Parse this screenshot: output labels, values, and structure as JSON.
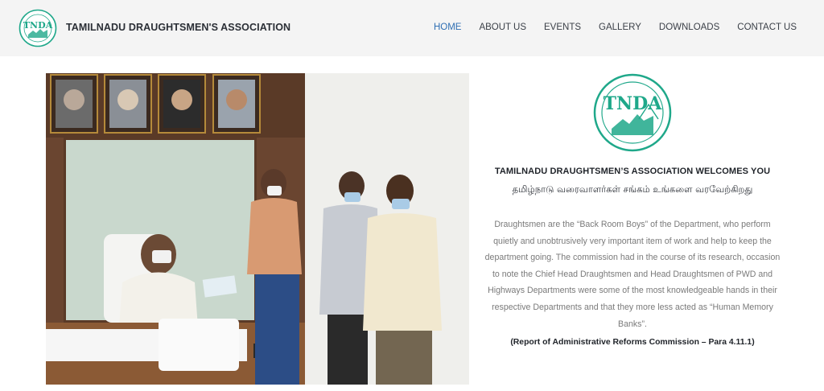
{
  "header": {
    "site_title": "TAMILNADU DRAUGHTSMEN'S ASSOCIATION",
    "logo_text": "TNDA",
    "nav": [
      {
        "label": "HOME",
        "active": true
      },
      {
        "label": "ABOUT US",
        "active": false
      },
      {
        "label": "EVENTS",
        "active": false
      },
      {
        "label": "GALLERY",
        "active": false
      },
      {
        "label": "DOWNLOADS",
        "active": false
      },
      {
        "label": "CONTACT US",
        "active": false
      }
    ]
  },
  "hero": {
    "logo_text": "TNDA",
    "logo_ring_text": "TAMILNADU DRAUGHTSMEN'S ASSOCIATION",
    "welcome": "TAMILNADU DRAUGHTSMEN’S ASSOCIATION WELCOMES YOU",
    "welcome_tamil": "தமிழ்நாடு வரைவாளர்கள் சங்கம் உங்களை வரவேற்கிறது",
    "description": "Draughtsmen are the “Back Room Boys” of the Department, who perform quietly and unobtrusively very important item of work and help to keep the department going. The commission had in the course of its research, occasion to note the Chief Head Draughtsmen and Head Draughtsmen of PWD and Highways Departments were some of the most knowledgeable hands in their respective Departments and that they more less acted as “Human Memory Banks”.",
    "citation": "(Report of Administrative Reforms Commission – Para 4.11.1)"
  },
  "colors": {
    "header_bg": "#f4f4f4",
    "nav_active": "#2f6fb3",
    "logo_green": "#1fa88a"
  },
  "icons": {
    "logo": "tnda-emblem-icon"
  }
}
